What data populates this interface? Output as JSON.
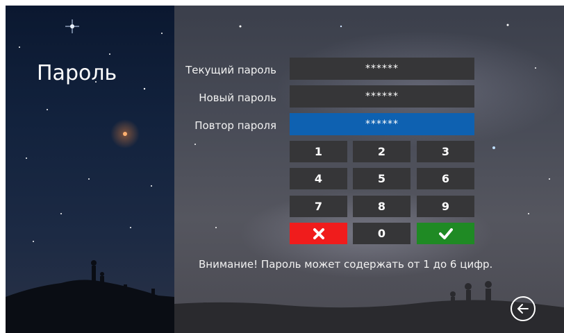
{
  "page": {
    "title": "Пароль"
  },
  "form": {
    "current": {
      "label": "Текущий пароль",
      "value": "******"
    },
    "new": {
      "label": "Новый пароль",
      "value": "******"
    },
    "repeat": {
      "label": "Повтор пароля",
      "value": "******"
    }
  },
  "keypad": {
    "keys": [
      "1",
      "2",
      "3",
      "4",
      "5",
      "6",
      "7",
      "8",
      "9"
    ],
    "zero": "0",
    "cancel_icon": "cross-icon",
    "confirm_icon": "checkmark-icon"
  },
  "notice": "Внимание! Пароль может содержать от 1 до 6 цифр.",
  "navigation": {
    "back_icon": "arrow-left-circle-icon"
  },
  "colors": {
    "active_field": "#0e61b1",
    "cancel": "#f01c1c",
    "confirm": "#1f8a24",
    "key_bg": "#363638"
  }
}
